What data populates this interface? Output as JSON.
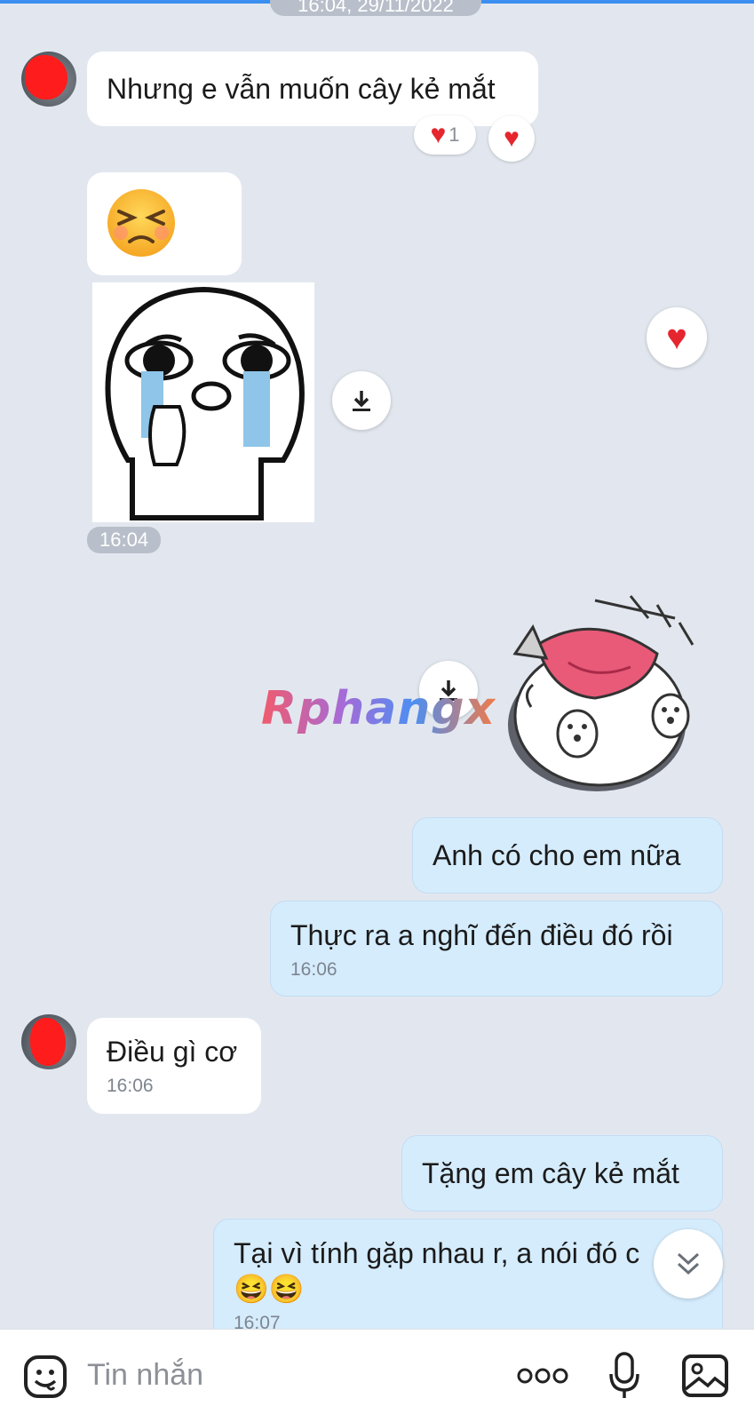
{
  "header": {
    "date_divider": "16:04, 29/11/2022"
  },
  "messages": [
    {
      "id": "m1",
      "side": "in",
      "text": "Nhưng e vẫn muốn cây kẻ mắt",
      "reactions": {
        "count": "1"
      }
    },
    {
      "id": "m2",
      "side": "in",
      "emoji": "😣"
    },
    {
      "id": "m3",
      "side": "in",
      "sticker": "crying-sticker",
      "time": "16:04"
    },
    {
      "id": "m4",
      "side": "out",
      "sticker": "cat-laughing-sticker"
    },
    {
      "id": "m5",
      "side": "out",
      "text": "Anh có cho em nữa"
    },
    {
      "id": "m6",
      "side": "out",
      "text": "Thực ra a nghĩ đến điều đó rồi",
      "time": "16:06"
    },
    {
      "id": "m7",
      "side": "in",
      "text": "Điều gì cơ",
      "time": "16:06"
    },
    {
      "id": "m8",
      "side": "out",
      "text": "Tặng em cây kẻ mắt"
    },
    {
      "id": "m9",
      "side": "out",
      "text": "Tại vì tính gặp nhau r, a nói đó c",
      "emojis": "😆😆",
      "time": "16:07"
    }
  ],
  "watermark": "Rphangx",
  "composer": {
    "placeholder": "Tin nhắn",
    "icons": [
      "sticker-icon",
      "more-icon",
      "microphone-icon",
      "image-icon"
    ]
  },
  "colors": {
    "background": "#e2e7ef",
    "incoming_bubble": "#ffffff",
    "outgoing_bubble": "#d5ecfd",
    "heart": "#e5262e",
    "accent": "#3b8ff0"
  }
}
